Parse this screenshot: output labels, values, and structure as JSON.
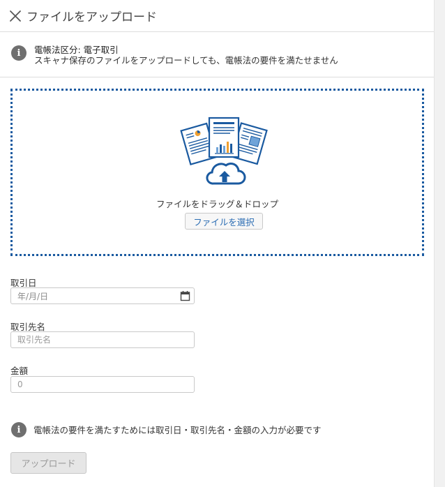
{
  "header": {
    "title": "ファイルをアップロード"
  },
  "notice": {
    "title": "電帳法区分: 電子取引",
    "message": "スキャナ保存のファイルをアップロードしても、電帳法の要件を満たせません"
  },
  "dropzone": {
    "label": "ファイルをドラッグ＆ドロップ",
    "select_button": "ファイルを選択"
  },
  "form": {
    "transaction_date": {
      "label": "取引日",
      "placeholder": "年/月/日"
    },
    "partner": {
      "label": "取引先名",
      "placeholder": "取引先名"
    },
    "amount": {
      "label": "金額",
      "placeholder": "0"
    }
  },
  "requirement_note": "電帳法の要件を満たすためには取引日・取引先名・金額の入力が必要です",
  "upload_button": "アップロード",
  "colors": {
    "accent": "#1a5aa0",
    "link": "#2a6cb3",
    "icon_gray": "#6f6f6f"
  }
}
